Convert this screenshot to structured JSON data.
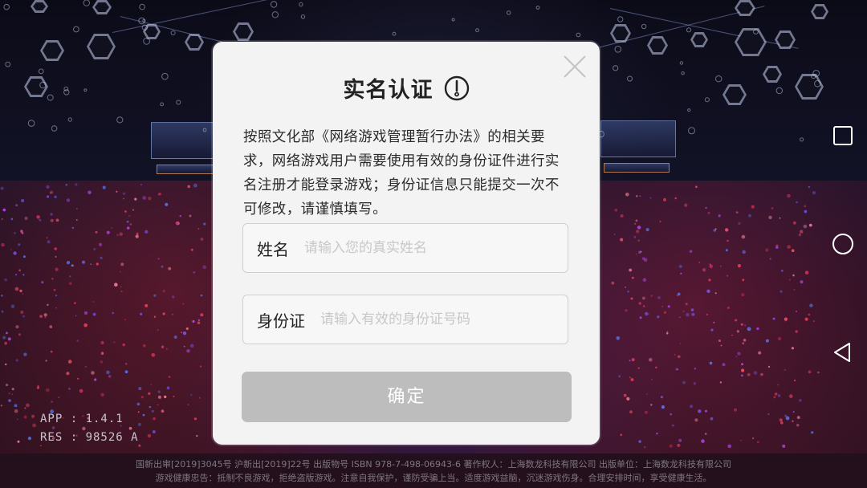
{
  "dialog": {
    "title": "实名认证",
    "description": "按照文化部《网络游戏管理暂行办法》的相关要求，网络游戏用户需要使用有效的身份证件进行实名注册才能登录游戏；身份证信息只能提交一次不可修改，请谨慎填写。",
    "name_field": {
      "label": "姓名",
      "value": "",
      "placeholder": "请输入您的真实姓名"
    },
    "id_field": {
      "label": "身份证",
      "value": "",
      "placeholder": "请输入有效的身份证号码"
    },
    "confirm_label": "确定",
    "icons": {
      "close": "close-icon",
      "info": "info-icon"
    }
  },
  "game_overlay": {
    "app_version": "APP : 1.4.1",
    "res_version": "RES : 98526 A",
    "footer_line1": "国新出审[2019]3045号   沪新出[2019]22号   出版物号 ISBN 978-7-498-06943-6   著作权人：上海数龙科技有限公司   出版单位：上海数龙科技有限公司",
    "footer_line2": "游戏健康忠告：抵制不良游戏，拒绝盗版游戏。注意自我保护，谨防受骗上当。适度游戏益脑，沉迷游戏伤身。合理安排时间，享受健康生活。"
  },
  "nav_bar": {
    "buttons": [
      "recents-icon",
      "home-icon",
      "back-icon"
    ]
  },
  "colors": {
    "dialog_bg": "#f3f3f3",
    "confirm_disabled": "#bdbdbd",
    "placeholder": "#c8c8c8"
  }
}
